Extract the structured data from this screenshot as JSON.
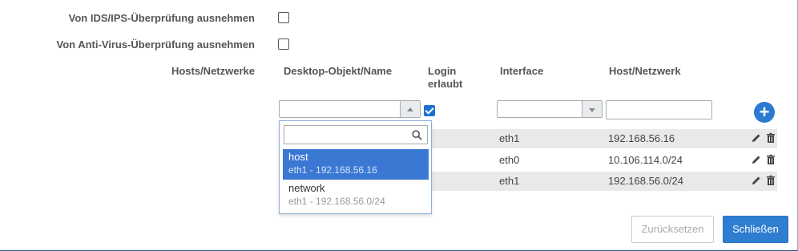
{
  "form": {
    "ids_label": "Von IDS/IPS-Überprüfung ausnehmen",
    "av_label": "Von Anti-Virus-Überprüfung ausnehmen",
    "hosts_label": "Hosts/Netzwerke"
  },
  "table": {
    "headers": {
      "object": "Desktop-Objekt/Name",
      "login_line1": "Login",
      "login_line2": "erlaubt",
      "interface": "Interface",
      "host": "Host/Netzwerk"
    },
    "new_row": {
      "login_allowed": true
    },
    "rows": [
      {
        "interface": "eth1",
        "host": "192.168.56.16"
      },
      {
        "interface": "eth0",
        "host": "10.106.114.0/24"
      },
      {
        "interface": "eth1",
        "host": "192.168.56.0/24"
      }
    ]
  },
  "dropdown": {
    "search_value": "",
    "options": [
      {
        "name": "host",
        "detail": "eth1 - 192.168.56.16",
        "selected": true
      },
      {
        "name": "network",
        "detail": "eth1 - 192.168.56.0/24",
        "selected": false
      }
    ]
  },
  "buttons": {
    "reset": "Zurücksetzen",
    "close": "Schließen",
    "add": "+"
  },
  "colors": {
    "primary": "#2f7dd0",
    "selected_option": "#3a78d4",
    "row_shade": "#e9e9e9"
  },
  "icons": {
    "edit": "pencil-icon",
    "delete": "trash-icon",
    "search": "search-icon",
    "add": "plus-icon"
  }
}
